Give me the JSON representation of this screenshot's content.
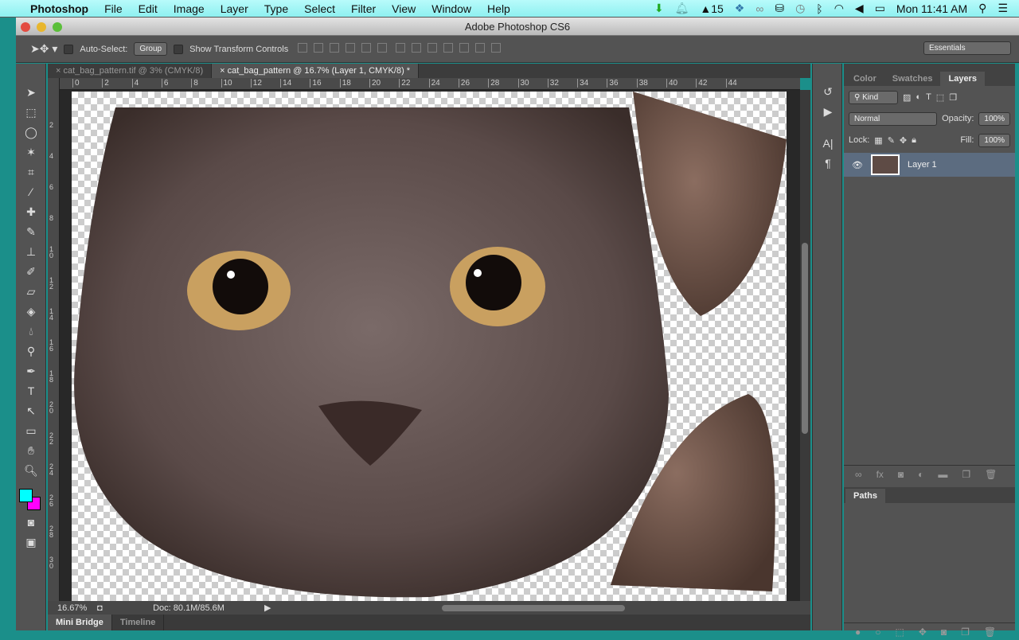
{
  "menubar": {
    "apple": "",
    "app": "Photoshop",
    "items": [
      "File",
      "Edit",
      "Image",
      "Layer",
      "Type",
      "Select",
      "Filter",
      "View",
      "Window",
      "Help"
    ],
    "status": {
      "adobe_count": "15",
      "clock": "Mon 11:41 AM"
    }
  },
  "window": {
    "title": "Adobe Photoshop CS6"
  },
  "options": {
    "auto_select_label": "Auto-Select:",
    "auto_select_value": "Group",
    "show_transform_label": "Show Transform Controls",
    "workspace": "Essentials"
  },
  "doc_tabs": [
    {
      "label": "cat_bag_pattern.tif @ 3% (CMYK/8)"
    },
    {
      "label": "cat_bag_pattern @ 16.7% (Layer 1, CMYK/8) *"
    }
  ],
  "ruler_top": [
    "0",
    "2",
    "4",
    "6",
    "8",
    "10",
    "12",
    "14",
    "16",
    "18",
    "20",
    "22",
    "24",
    "26",
    "28",
    "30",
    "32",
    "34",
    "36",
    "38",
    "40",
    "42",
    "44"
  ],
  "ruler_left": [
    "2",
    "4",
    "6",
    "8",
    "10",
    "12",
    "14",
    "16",
    "18",
    "20",
    "22",
    "24",
    "26",
    "28",
    "30"
  ],
  "statusbar": {
    "zoom": "16.67%",
    "doc": "Doc: 80.1M/85.6M"
  },
  "bottom_tabs": [
    "Mini Bridge",
    "Timeline"
  ],
  "layers_panel": {
    "tabs": [
      "Color",
      "Swatches",
      "Layers"
    ],
    "active_tab": "Layers",
    "filter": "Kind",
    "blend_mode": "Normal",
    "opacity_label": "Opacity:",
    "opacity": "100%",
    "lock_label": "Lock:",
    "fill_label": "Fill:",
    "fill": "100%",
    "layers": [
      {
        "name": "Layer 1",
        "visible": true,
        "selected": true
      }
    ]
  },
  "paths_panel": {
    "title": "Paths"
  },
  "colors": {
    "foreground": "#00ffff",
    "background": "#ff00ff",
    "selected_layer": "#5c6c80"
  }
}
